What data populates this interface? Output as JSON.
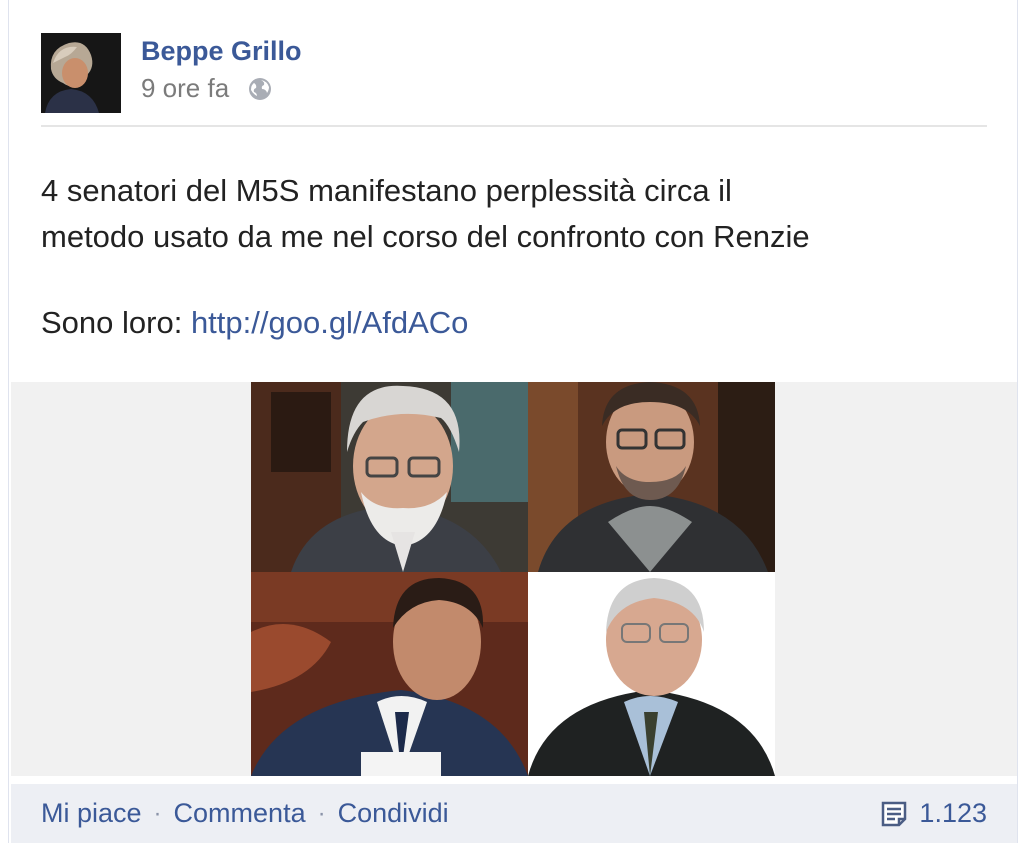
{
  "post": {
    "author": "Beppe Grillo",
    "timestamp": "9 ore fa",
    "privacy_icon": "globe-icon",
    "text_line1": "4 senatori del M5S manifestano perplessità circa il",
    "text_line2": "metodo usato da me nel corso del confronto con Renzie",
    "text_prefix": "Sono loro: ",
    "link": "http://goo.gl/AfdACo"
  },
  "actions": {
    "like": "Mi piace",
    "comment": "Commenta",
    "share": "Condividi",
    "separator": "·"
  },
  "comments": {
    "icon": "comment-icon",
    "count": "1.123"
  },
  "colors": {
    "link_blue": "#3b5998",
    "action_bar": "#edeff4"
  }
}
